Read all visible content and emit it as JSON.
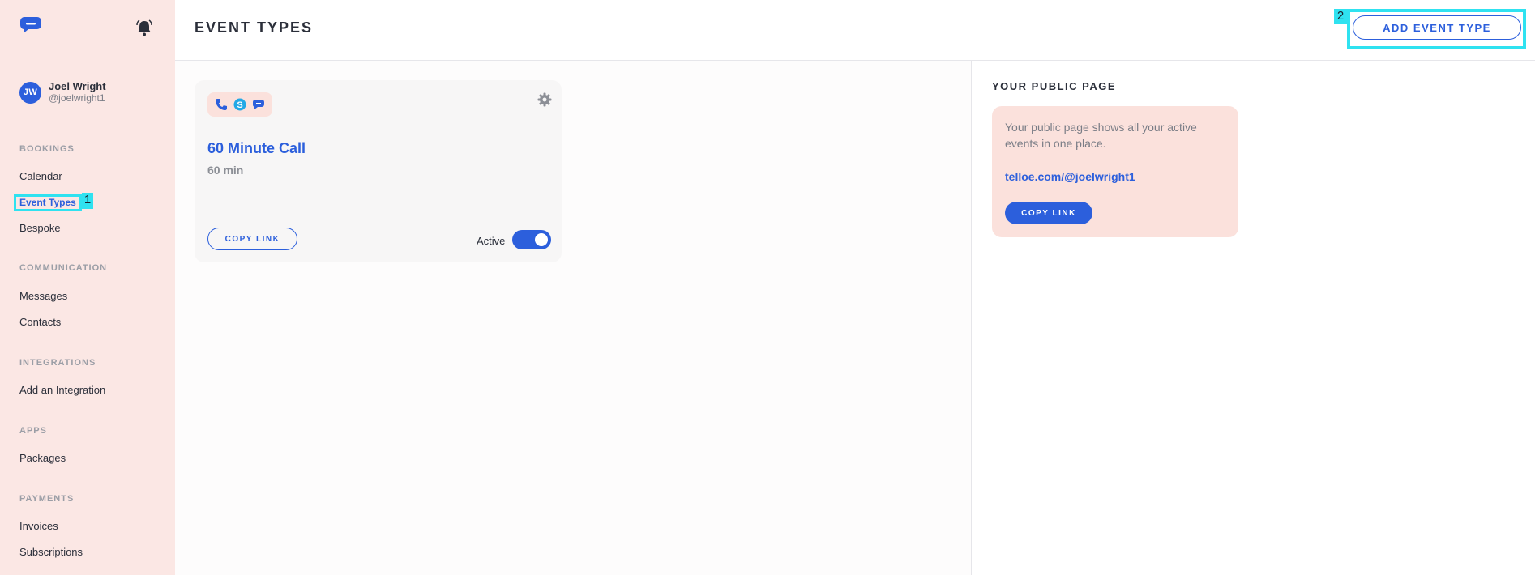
{
  "user": {
    "initials": "JW",
    "name": "Joel Wright",
    "handle": "@joelwright1"
  },
  "sidebar": {
    "sections": {
      "bookings": "BOOKINGS",
      "communication": "COMMUNICATION",
      "integrations": "INTEGRATIONS",
      "apps": "APPS",
      "payments": "PAYMENTS"
    },
    "items": {
      "calendar": "Calendar",
      "event_types": "Event Types",
      "bespoke": "Bespoke",
      "messages": "Messages",
      "contacts": "Contacts",
      "add_integration": "Add an Integration",
      "packages": "Packages",
      "invoices": "Invoices",
      "subscriptions": "Subscriptions"
    },
    "active_item": "Event Types"
  },
  "markers": {
    "first": "1",
    "second": "2"
  },
  "header": {
    "title": "EVENT TYPES",
    "add_button": "ADD EVENT TYPE"
  },
  "event_card": {
    "title": "60 Minute Call",
    "duration": "60 min",
    "channels": [
      "phone-icon",
      "skype-icon",
      "chat-icon"
    ],
    "copy_link": "COPY LINK",
    "active_label": "Active",
    "active": true
  },
  "public_page": {
    "title": "YOUR PUBLIC PAGE",
    "description": "Your public page shows all your active events in one place.",
    "link": "telloe.com/@joelwright1",
    "copy_link": "COPY LINK"
  },
  "colors": {
    "accent": "#2c5fdc",
    "sidebar_bg": "#fbe7e4",
    "highlight": "#2fe2f0"
  }
}
